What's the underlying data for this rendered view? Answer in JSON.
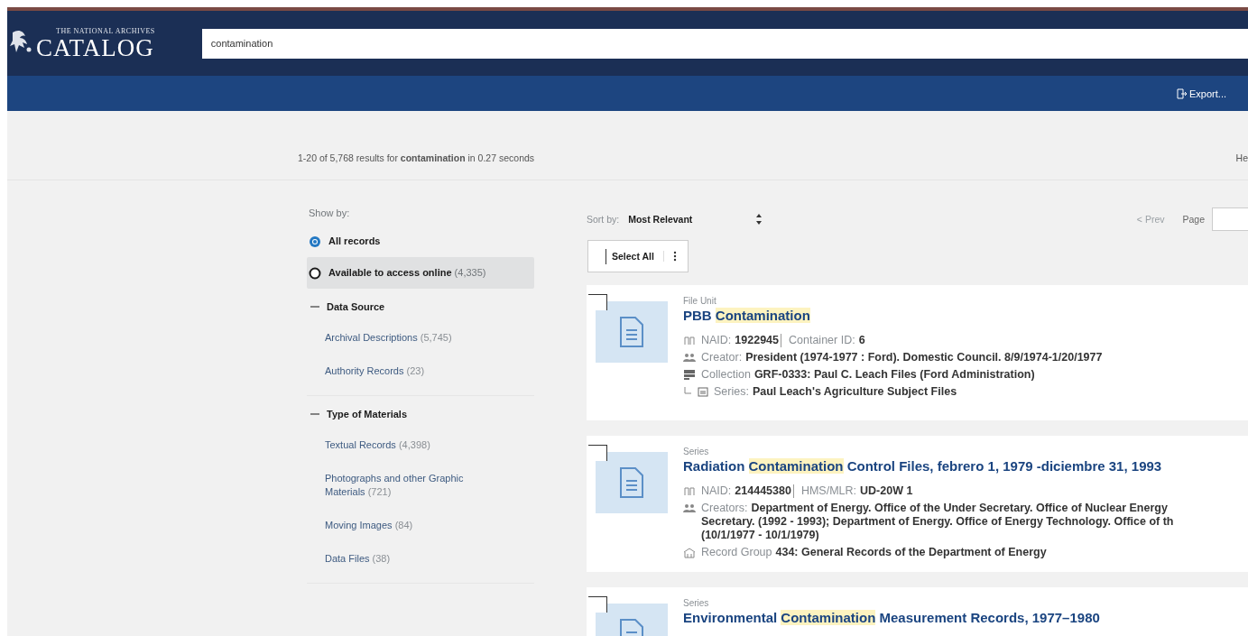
{
  "header": {
    "logo_small": "THE NATIONAL ARCHIVES",
    "logo": "CATALOG",
    "search": {
      "value": "contamination"
    },
    "export_button": "Export..."
  },
  "summary": {
    "text": "1-20 of 5,768 results for **contamination** in 0.27 seconds",
    "right_link": "He"
  },
  "filters": {
    "show_by": {
      "label": "Show by:",
      "options": [
        {
          "label": "All records",
          "selected": true
        },
        {
          "label": "Available to access online",
          "count": "(4,335)",
          "selected": false
        }
      ]
    },
    "sections": [
      {
        "title": "Data Source",
        "expanded": true,
        "items": [
          {
            "label": "Archival Descriptions",
            "count": "(5,745)"
          },
          {
            "label": "Authority Records",
            "count": "(23)"
          }
        ]
      },
      {
        "title": "Type of Materials",
        "expanded": true,
        "items": [
          {
            "label": "Textual Records",
            "count": "(4,398)"
          },
          {
            "label": "Photographs and other Graphic Materials",
            "count": "(721)"
          },
          {
            "label": "Moving Images",
            "count": "(84)"
          },
          {
            "label": "Data Files",
            "count": "(38)"
          }
        ]
      }
    ]
  },
  "toolbar": {
    "sort_label": "Sort by:",
    "sort_value": "Most Relevant",
    "prev": {
      "label": "< Prev",
      "disabled": true
    },
    "page_label": "Page",
    "select_all": {
      "label": "Select All",
      "checked": false
    }
  },
  "results": [
    {
      "type": "File Unit",
      "checked": false,
      "title_parts": [
        {
          "text": "PBB ",
          "highlighted": false
        },
        {
          "text": "Contamination",
          "highlighted": true
        }
      ],
      "meta": [
        {
          "kind": "id",
          "items": [
            {
              "label": "NAID:",
              "value": "1922945"
            },
            {
              "label": "Container ID:",
              "value": "6"
            }
          ]
        },
        {
          "kind": "creator",
          "items": [
            {
              "label": "Creator:",
              "value": "President (1974-1977 : Ford). Domestic Council. 8/9/1974-1/20/1977"
            }
          ]
        },
        {
          "kind": "collection",
          "items": [
            {
              "label": "Collection",
              "value": "GRF-0333: Paul C. Leach Files (Ford Administration)"
            }
          ]
        },
        {
          "kind": "series",
          "items": [
            {
              "label": "Series:",
              "value": "Paul Leach's Agriculture Subject Files"
            }
          ]
        }
      ]
    },
    {
      "type": "Series",
      "checked": false,
      "title_parts": [
        {
          "text": "Radiation ",
          "highlighted": false
        },
        {
          "text": "Contamination",
          "highlighted": true
        },
        {
          "text": " Control Files, febrero 1, 1979 -diciembre 31, 1993",
          "highlighted": false
        }
      ],
      "meta": [
        {
          "kind": "id",
          "items": [
            {
              "label": "NAID:",
              "value": "214445380"
            },
            {
              "label": "HMS/MLR:",
              "value": "UD-20W 1"
            }
          ]
        },
        {
          "kind": "creator",
          "items": [
            {
              "label": "Creators:",
              "value": "Department of Energy. Office of the Under Secretary. Office of Nuclear Energy",
              "more": [
                "Secretary. (1992 - 1993); Department of Energy. Office of Energy Technology. Office of th",
                "(10/1/1977 - 10/1/1979)"
              ]
            }
          ]
        },
        {
          "kind": "record-group",
          "items": [
            {
              "label": "Record Group",
              "value": "434: General Records of the Department of Energy"
            }
          ]
        }
      ]
    },
    {
      "type": "Series",
      "checked": false,
      "title_parts": [
        {
          "text": "Environmental ",
          "highlighted": false
        },
        {
          "text": "Contamination",
          "highlighted": true
        },
        {
          "text": " Measurement Records, 1977–1980",
          "highlighted": false
        }
      ]
    }
  ]
}
